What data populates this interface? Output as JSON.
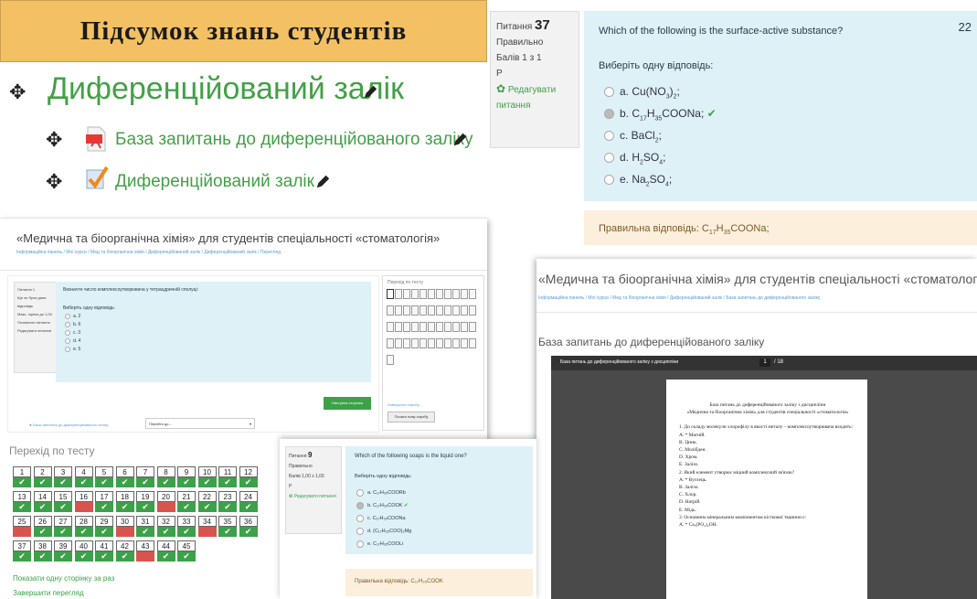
{
  "banner": {
    "title": "Підсумок  знань студентів"
  },
  "course": {
    "section_title": "Диференційований залік",
    "items": [
      {
        "label": "База запитань до диференційованого заліку",
        "icon": "pdf-icon"
      },
      {
        "label": "Диференційований залік",
        "icon": "quiz-check-icon"
      }
    ]
  },
  "q37": {
    "info_label": "Питання",
    "number": "37",
    "status": "Правильно",
    "score": "Балів 1 з 1",
    "flag": "Р",
    "edit": "Редагувати питання",
    "corner_num": "22",
    "question": "Which of the following is the surface-active substance?",
    "prompt": "Виберіть одну відповідь:",
    "answers": [
      {
        "prefix": "a. Cu(NO",
        "sub": "3",
        "suffix": ")",
        "sub2": "2",
        "end": ";",
        "selected": false,
        "correct": false
      },
      {
        "prefix": "b. C",
        "sub": "17",
        "suffix": "H",
        "sub2": "35",
        "end": "COONa;",
        "selected": true,
        "correct": true
      },
      {
        "prefix": "c. BaCl",
        "sub": "2",
        "suffix": ";",
        "sub2": "",
        "end": "",
        "selected": false,
        "correct": false
      },
      {
        "prefix": "d. H",
        "sub": "2",
        "suffix": "SO",
        "sub2": "4",
        "end": ";",
        "selected": false,
        "correct": false
      },
      {
        "prefix": "e. Na",
        "sub": "2",
        "suffix": "SO",
        "sub2": "4",
        "end": ";",
        "selected": false,
        "correct": false
      }
    ],
    "correct_prefix": "Правильна відповідь: C",
    "correct_sub": "17",
    "correct_mid": "H",
    "correct_sub2": "35",
    "correct_end": "COONa;"
  },
  "quizpage": {
    "heading": "«Медична та біоорганічна хімія» для студентів спеціальності «стоматологія»",
    "breadcrumb": "Інформаційна панель / Мої курси / Мед та біоорганічна хімія / Диференційований залік / Диференційований залік / Перегляд",
    "question_text": "Визначте число комплексоутворювача у тетраєдричній сполуці:",
    "prompt": "Виберіть одну відповідь:",
    "answers": [
      "a. 2",
      "b. 6",
      "c. 3",
      "d. 4",
      "e. 5"
    ],
    "info": [
      "Питання 1",
      "Ще не була дана відповідь",
      "Макс. оцінка до 1,00",
      "Позначити питання",
      "Редагувати питання"
    ],
    "next_button": "Наступна сторінка",
    "nav_title": "Перехід по тесту",
    "finish_link": "Завершити спробу...",
    "new_preview": "Почати нову спробу",
    "back_link": "◄ База запитань до диференційованого заліку",
    "jump_select": "Перейти до..."
  },
  "docpage": {
    "heading": "«Медична та біоорганічна хімія» для студентів спеціальності «стоматологія»",
    "breadcrumb": "Інформаційна панель / Мої курси / Мед та біоорганічна хімія / Диференційований залік / База запитань до диференційованого заліку",
    "resource_title": "База запитань до диференційованого заліку",
    "viewer_title": "База питань до диференційованого заліку з дисципліни",
    "viewer_page": "1",
    "viewer_total": "/ 18",
    "doc_lines": [
      "База питань до диференційованого заліку з дисципліни",
      "«Медична та біоорганічна хімія» для студентів спеціальності «стоматологія»",
      "1. До складу молекули хлорофілу в якості металу – комплексоутворювача входить:",
      "А. * Магній.",
      "В. Цинк.",
      "С. Молібден.",
      "D. Хром.",
      "Е. Залізо.",
      "2. Який елемент утворює міцний комплексний зв'язок?",
      "А. * Вуглець.",
      "В. Залізо.",
      "С. Хлор.",
      "D. Натрій.",
      "Е. Мідь.",
      "3. Основним мінеральним компонентом кісткової тканини є:",
      "А. * Ca₃(PO₄)₂OH."
    ]
  },
  "nav": {
    "title": "Перехід по тесту",
    "show_one_page": "Показати одну сторінку за раз",
    "finish_review": "Завершити перегляд",
    "cells": [
      {
        "n": "1",
        "s": "ok"
      },
      {
        "n": "2",
        "s": "ok"
      },
      {
        "n": "3",
        "s": "ok"
      },
      {
        "n": "4",
        "s": "ok"
      },
      {
        "n": "5",
        "s": "ok"
      },
      {
        "n": "6",
        "s": "ok"
      },
      {
        "n": "7",
        "s": "ok"
      },
      {
        "n": "8",
        "s": "ok"
      },
      {
        "n": "9",
        "s": "ok"
      },
      {
        "n": "10",
        "s": "ok"
      },
      {
        "n": "11",
        "s": "ok"
      },
      {
        "n": "12",
        "s": "ok"
      },
      {
        "n": "13",
        "s": "ok"
      },
      {
        "n": "14",
        "s": "ok"
      },
      {
        "n": "15",
        "s": "ok"
      },
      {
        "n": "16",
        "s": "bad"
      },
      {
        "n": "17",
        "s": "ok"
      },
      {
        "n": "18",
        "s": "ok"
      },
      {
        "n": "19",
        "s": "ok"
      },
      {
        "n": "20",
        "s": "bad"
      },
      {
        "n": "21",
        "s": "ok"
      },
      {
        "n": "22",
        "s": "ok"
      },
      {
        "n": "23",
        "s": "ok"
      },
      {
        "n": "24",
        "s": "ok"
      },
      {
        "n": "25",
        "s": "bad"
      },
      {
        "n": "26",
        "s": "ok"
      },
      {
        "n": "27",
        "s": "ok"
      },
      {
        "n": "28",
        "s": "ok"
      },
      {
        "n": "29",
        "s": "ok"
      },
      {
        "n": "30",
        "s": "bad"
      },
      {
        "n": "31",
        "s": "ok"
      },
      {
        "n": "32",
        "s": "ok"
      },
      {
        "n": "33",
        "s": "ok"
      },
      {
        "n": "34",
        "s": "bad"
      },
      {
        "n": "35",
        "s": "ok"
      },
      {
        "n": "36",
        "s": "ok"
      },
      {
        "n": "37",
        "s": "ok"
      },
      {
        "n": "38",
        "s": "ok"
      },
      {
        "n": "39",
        "s": "ok"
      },
      {
        "n": "40",
        "s": "ok"
      },
      {
        "n": "41",
        "s": "ok"
      },
      {
        "n": "42",
        "s": "ok"
      },
      {
        "n": "43",
        "s": "bad"
      },
      {
        "n": "44",
        "s": "ok"
      },
      {
        "n": "45",
        "s": "ok"
      }
    ]
  },
  "q9": {
    "info_label": "Питання",
    "number": "9",
    "status": "Правильно",
    "score": "Балів 1,00 з 1,00",
    "flag": "Р",
    "edit": "Редагувати питання",
    "question": "Which of the following soaps is the liquid one?",
    "prompt": "Виберіть одну відповідь:",
    "answers": [
      {
        "text": "a. C₁₇H₃₅COORb",
        "selected": false,
        "correct": false
      },
      {
        "text": "b. C₁₇H₃₅COOK",
        "selected": true,
        "correct": true
      },
      {
        "text": "c. C₁₇H₃₅COONa",
        "selected": false,
        "correct": false
      },
      {
        "text": "d. (C₁₇H₃₅COO)₂Mg",
        "selected": false,
        "correct": false
      },
      {
        "text": "e. C₁₇H₃₅COOLi",
        "selected": false,
        "correct": false
      }
    ],
    "correct": "Правильна відповідь: C₁₇H₃₅COOK"
  },
  "colors": {
    "ok": "#3da14a",
    "bad": "#d9534f",
    "link": "#2e7d32",
    "banner": "#f3c063",
    "question_bg": "#def1f7",
    "feedback_bg": "#fcefdc"
  }
}
